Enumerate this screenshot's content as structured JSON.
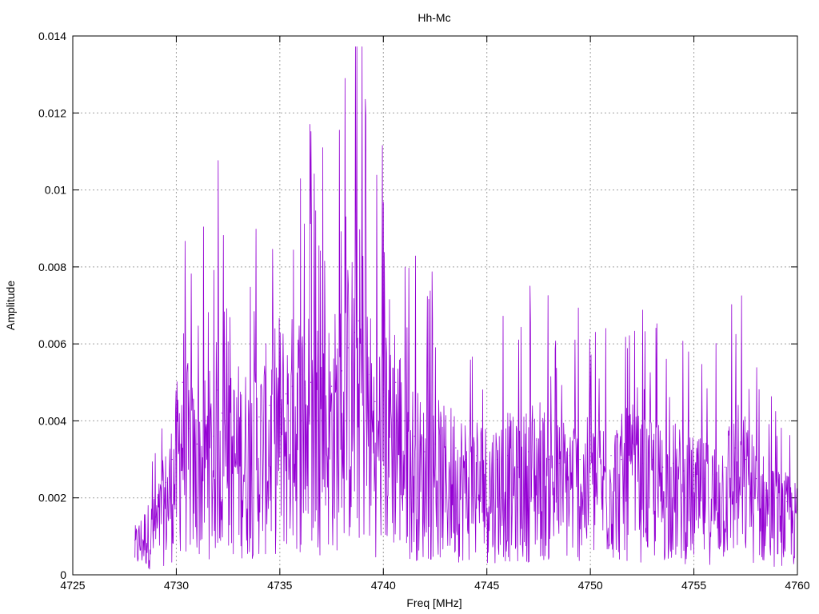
{
  "chart_data": {
    "type": "line",
    "title": "Hh-Mc",
    "xlabel": "Freq [MHz]",
    "ylabel": "Amplitude",
    "xlim": [
      4725,
      4760
    ],
    "ylim": [
      0,
      0.014
    ],
    "x_ticks": [
      "4725",
      "4730",
      "4735",
      "4740",
      "4745",
      "4750",
      "4755",
      "4760"
    ],
    "y_ticks": [
      "0",
      "0.002",
      "0.004",
      "0.006",
      "0.008",
      "0.01",
      "0.012",
      "0.014"
    ],
    "grid": true,
    "line_color": "#9400d3",
    "series": [
      {
        "x": [
          4728.0,
          4728.5,
          4729.0,
          4729.5,
          4729.8,
          4730.0,
          4730.3,
          4730.6,
          4731.0,
          4731.5,
          4731.8,
          4732.0,
          4732.2,
          4732.5,
          4733.0,
          4733.5,
          4734.0,
          4734.5,
          4735.0,
          4735.3,
          4735.6,
          4736.0,
          4736.5,
          4737.0,
          4737.5,
          4738.0,
          4738.3,
          4738.6,
          4738.8,
          4739.0,
          4739.3,
          4739.6,
          4740.0,
          4740.3,
          4740.6,
          4741.0,
          4741.5,
          4742.0,
          4742.5,
          4743.0,
          4743.5,
          4744.0,
          4744.5,
          4745.0,
          4745.5,
          4746.0,
          4746.5,
          4747.0,
          4747.4,
          4748.0,
          4748.5,
          4749.0,
          4749.5,
          4750.0,
          4750.5,
          4751.0,
          4751.5,
          4752.0,
          4752.5,
          4753.0,
          4753.5,
          4754.0,
          4754.5,
          4755.0,
          4755.5,
          4756.0,
          4756.5,
          4757.0,
          4757.5,
          4758.0,
          4758.5,
          4759.0,
          4759.5,
          4760.0
        ],
        "y": [
          0.0009,
          0.0013,
          0.0015,
          0.0024,
          0.003,
          0.0035,
          0.005,
          0.0038,
          0.0034,
          0.004,
          0.0036,
          0.0048,
          0.0042,
          0.0037,
          0.004,
          0.0039,
          0.0041,
          0.0044,
          0.005,
          0.0047,
          0.0049,
          0.0052,
          0.005,
          0.0051,
          0.0049,
          0.0053,
          0.0059,
          0.0063,
          0.0066,
          0.0065,
          0.0052,
          0.0045,
          0.0048,
          0.0054,
          0.005,
          0.004,
          0.0036,
          0.0032,
          0.0034,
          0.0031,
          0.0033,
          0.003,
          0.0031,
          0.0029,
          0.003,
          0.0031,
          0.0028,
          0.0032,
          0.0035,
          0.003,
          0.0029,
          0.0031,
          0.003,
          0.0029,
          0.003,
          0.0031,
          0.003,
          0.0032,
          0.0029,
          0.003,
          0.0028,
          0.0029,
          0.0027,
          0.0026,
          0.0025,
          0.0026,
          0.0028,
          0.0033,
          0.003,
          0.0025,
          0.0022,
          0.002,
          0.0019,
          0.0017
        ]
      }
    ]
  }
}
